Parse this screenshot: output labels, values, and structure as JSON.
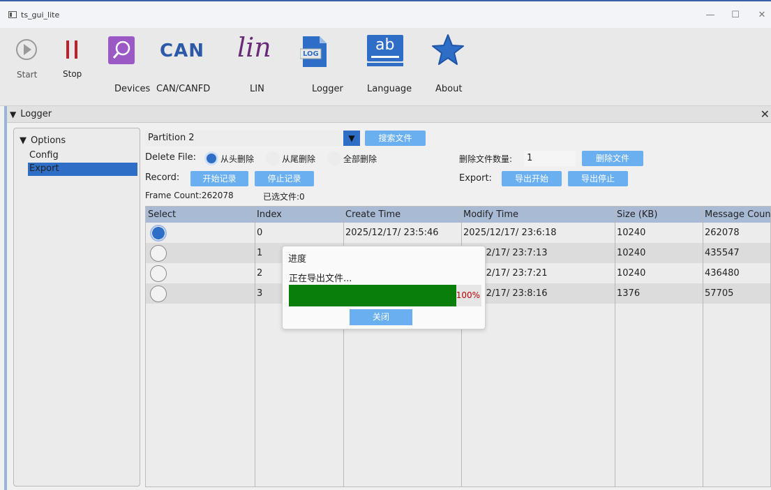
{
  "window": {
    "title": "ts_gui_lite",
    "minimize": "—",
    "maximize": "☐",
    "close": "✕"
  },
  "toolbar": {
    "start": "Start",
    "stop": "Stop",
    "devices": "Devices",
    "can": "CAN/CANFD",
    "can_logo": "CAN",
    "lin": "LIN",
    "lin_logo": "lin",
    "logger": "Logger",
    "log_logo": "LOG",
    "language": "Language",
    "lang_logo": "ab",
    "about": "About"
  },
  "dock": {
    "title": "Logger",
    "close": "✕"
  },
  "options": {
    "header": "Options",
    "items": [
      "Config",
      "Export"
    ],
    "selected": "Export"
  },
  "main": {
    "partition": "Partition 2",
    "search_button": "搜索文件",
    "delete_file_label": "Delete File:",
    "delete_options": [
      "从头删除",
      "从尾删除",
      "全部删除"
    ],
    "delete_count_label": "删除文件数量:",
    "delete_count_value": "1",
    "delete_button": "删除文件",
    "record_label": "Record:",
    "start_record": "开始记录",
    "stop_record": "停止记录",
    "export_label": "Export:",
    "export_start": "导出开始",
    "export_stop": "导出停止",
    "frame_count": "Frame Count:262078",
    "selected_files": "已选文件:0"
  },
  "table": {
    "headers": [
      "Select",
      "Index",
      "Create Time",
      "Modify Time",
      "Size (KB)",
      "Message Count"
    ],
    "rows": [
      {
        "index": "0",
        "create": "2025/12/17/ 23:5:46",
        "modify": "2025/12/17/ 23:6:18",
        "size": "10240",
        "count": "262078",
        "selected": true
      },
      {
        "index": "1",
        "create": "",
        "modify": "/12/17/ 23:7:13",
        "size": "10240",
        "count": "435547",
        "selected": false
      },
      {
        "index": "2",
        "create": "",
        "modify": "/12/17/ 23:7:21",
        "size": "10240",
        "count": "436480",
        "selected": false
      },
      {
        "index": "3",
        "create": "",
        "modify": "/12/17/ 23:8:16",
        "size": "1376",
        "count": "57705",
        "selected": false
      }
    ]
  },
  "dialog": {
    "title": "进度",
    "message": "正在导出文件...",
    "progress": 100,
    "progress_text": "100%",
    "close_button": "关闭"
  },
  "colors": {
    "accent": "#2f6ec6",
    "button": "#6aaff0",
    "progress": "#0a7e0a",
    "stop": "#c0202a"
  }
}
